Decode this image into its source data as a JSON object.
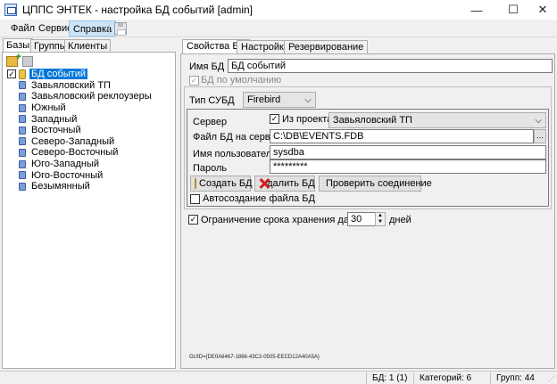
{
  "window": {
    "title": "ЦППС ЭНТЕК - настройка БД событий [admin]",
    "minimize_glyph": "—",
    "maximize_glyph": "☐",
    "close_glyph": "✕"
  },
  "menu": {
    "file": "Файл",
    "service": "Сервис",
    "help": "Справка"
  },
  "left_tabs": {
    "bases": "Базы",
    "groups": "Группы",
    "clients": "Клиенты"
  },
  "tree": {
    "root": {
      "label": "БД событий",
      "checked": "✓"
    },
    "children": [
      "Завьяловский ТП",
      "Завьяловский реклоузеры",
      "Южный",
      "Западный",
      "Восточный",
      "Северо-Западный",
      "Северо-Восточный",
      "Юго-Западный",
      "Юго-Восточный",
      "Безымянный"
    ]
  },
  "right_tabs": {
    "properties": "Свойства БД",
    "settings": "Настройки",
    "reserve": "Резервирование"
  },
  "props": {
    "db_name_label": "Имя БД",
    "db_name_value": "БД событий",
    "default_db_label": "БД по умолчанию",
    "default_db_checked": "✓",
    "dbms_label": "Тип СУБД",
    "dbms_value": "Firebird",
    "server_label": "Сервер",
    "from_project_label": "Из проекта",
    "from_project_checked": "✓",
    "server_value": "Завьяловский ТП",
    "db_file_label": "Файл БД на сервере",
    "db_file_value": "C:\\DB\\EVENTS.FDB",
    "browse_label": "...",
    "username_label": "Имя пользователя",
    "username_value": "sysdba",
    "password_label": "Пароль",
    "password_value": "*********",
    "create_btn": "Создать БД",
    "delete_btn": "Удалить БД",
    "check_btn": "Проверить соединение",
    "autocreate_label": "Автосоздание файла БД",
    "autocreate_checked": "",
    "retention_label": "Ограничение срока хранения данных",
    "retention_checked": "✓",
    "retention_value": "30",
    "retention_unit": "дней",
    "guid": "GUID={DE0A6467-1866-43C2-0505-EECD12A40A5A}"
  },
  "status": {
    "db": "БД: 1 (1)",
    "categories": "Категорий: 6",
    "groups": "Групп: 44"
  }
}
